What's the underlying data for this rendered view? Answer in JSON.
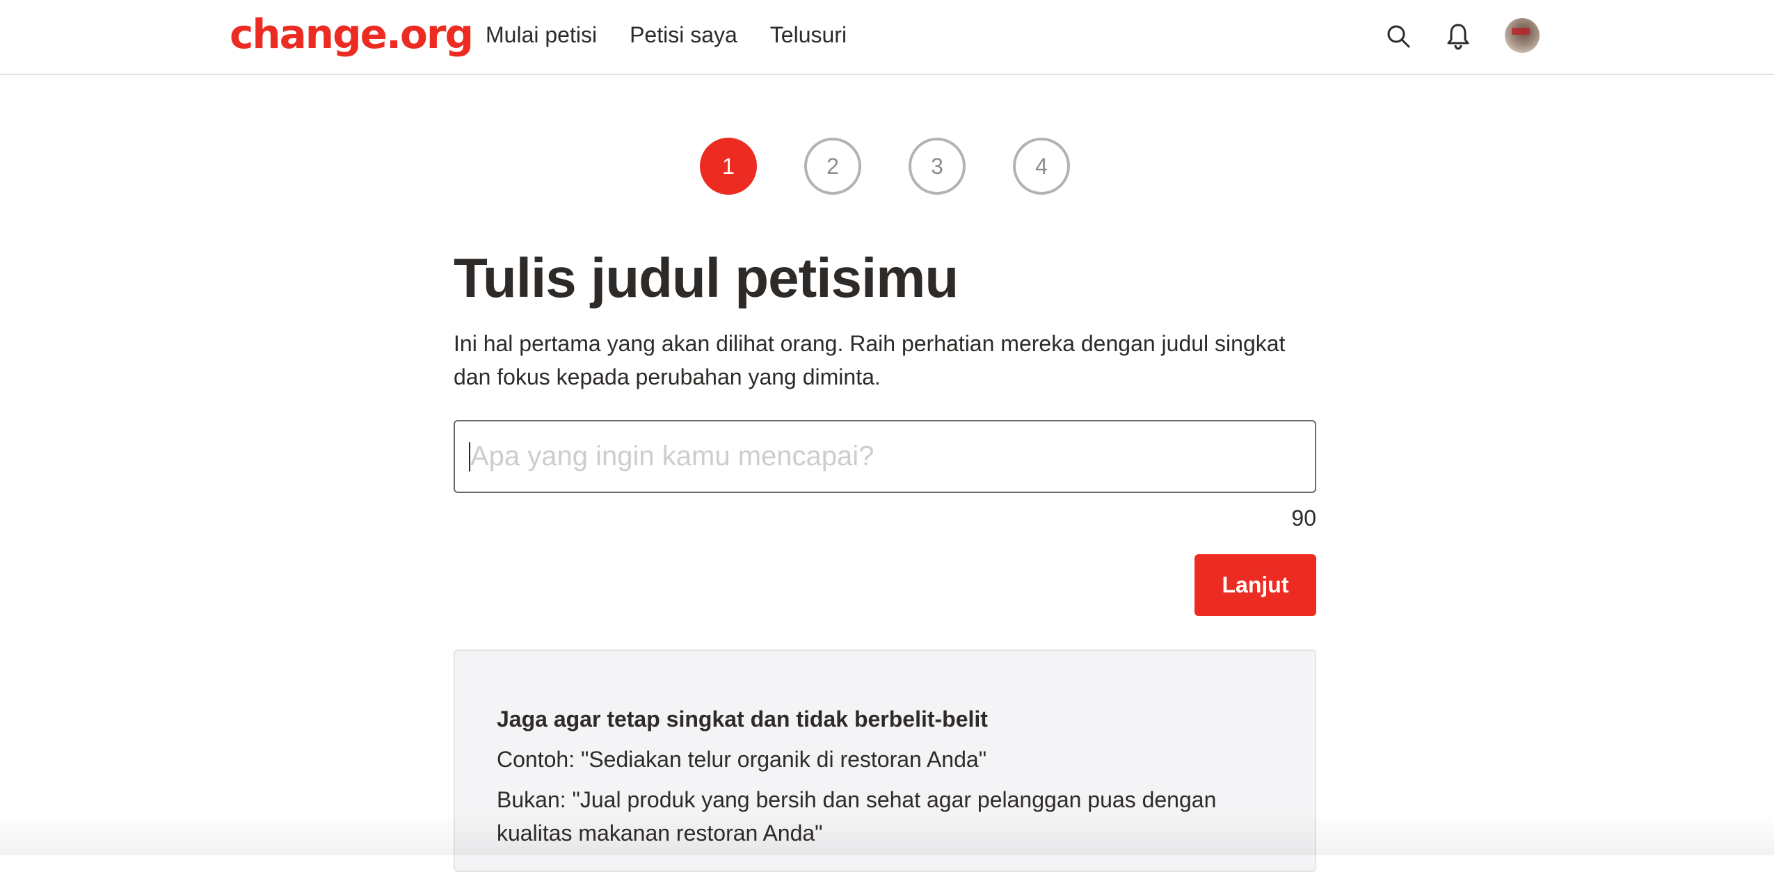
{
  "brand": {
    "logo_text": "change.org",
    "accent_color": "#ec2c22"
  },
  "header": {
    "nav": [
      {
        "label": "Mulai petisi"
      },
      {
        "label": "Petisi saya"
      },
      {
        "label": "Telusuri"
      }
    ],
    "icons": [
      "search-icon",
      "bell-icon",
      "avatar"
    ]
  },
  "stepper": {
    "steps": [
      "1",
      "2",
      "3",
      "4"
    ],
    "active_step": 1
  },
  "main": {
    "title": "Tulis judul petisimu",
    "subtitle": "Ini hal pertama yang akan dilihat orang. Raih perhatian mereka dengan judul singkat dan fokus kepada perubahan yang diminta.",
    "input": {
      "placeholder": "Apa yang ingin kamu mencapai?",
      "value": ""
    },
    "char_counter": "90",
    "next_button": "Lanjut"
  },
  "tips": {
    "heading": "Jaga agar tetap singkat dan tidak berbelit-belit",
    "example": "Contoh: \"Sediakan telur organik di restoran Anda\"",
    "counter_example": "Bukan: \"Jual produk yang bersih dan sehat agar pelanggan puas dengan kualitas makanan restoran Anda\""
  }
}
